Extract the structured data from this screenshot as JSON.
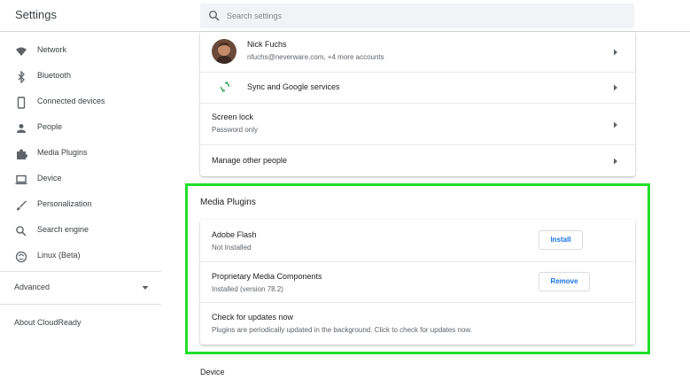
{
  "header": {
    "title": "Settings",
    "search_placeholder": "Search settings"
  },
  "sidebar": {
    "items": [
      {
        "label": "Network",
        "icon": "wifi-icon"
      },
      {
        "label": "Bluetooth",
        "icon": "bluetooth-icon"
      },
      {
        "label": "Connected devices",
        "icon": "phone-icon"
      },
      {
        "label": "People",
        "icon": "person-icon"
      },
      {
        "label": "Media Plugins",
        "icon": "puzzle-icon"
      },
      {
        "label": "Device",
        "icon": "laptop-icon"
      },
      {
        "label": "Personalization",
        "icon": "brush-icon"
      },
      {
        "label": "Search engine",
        "icon": "search-icon"
      },
      {
        "label": "Linux (Beta)",
        "icon": "linux-icon"
      }
    ],
    "advanced_label": "Advanced",
    "about_label": "About CloudReady"
  },
  "people": {
    "account_name": "Nick Fuchs",
    "account_sub": "nfuchs@neverware.com, +4 more accounts",
    "sync_label": "Sync and Google services",
    "screen_lock_title": "Screen lock",
    "screen_lock_sub": "Password only",
    "manage_label": "Manage other people"
  },
  "media_plugins": {
    "section_title": "Media Plugins",
    "flash_title": "Adobe Flash",
    "flash_status": "Not Installed",
    "install_label": "Install",
    "proprietary_title": "Proprietary Media Components",
    "proprietary_status": "Installed (version 78.2)",
    "remove_label": "Remove",
    "updates_title": "Check for updates now",
    "updates_sub": "Plugins are periodically updated in the background. Click to check for updates now."
  },
  "device_heading": "Device",
  "colors": {
    "accent_blue": "#1a73e8",
    "highlight_green": "#1fdf29",
    "sync_green": "#34a853",
    "icon_grey": "#5f6368"
  }
}
